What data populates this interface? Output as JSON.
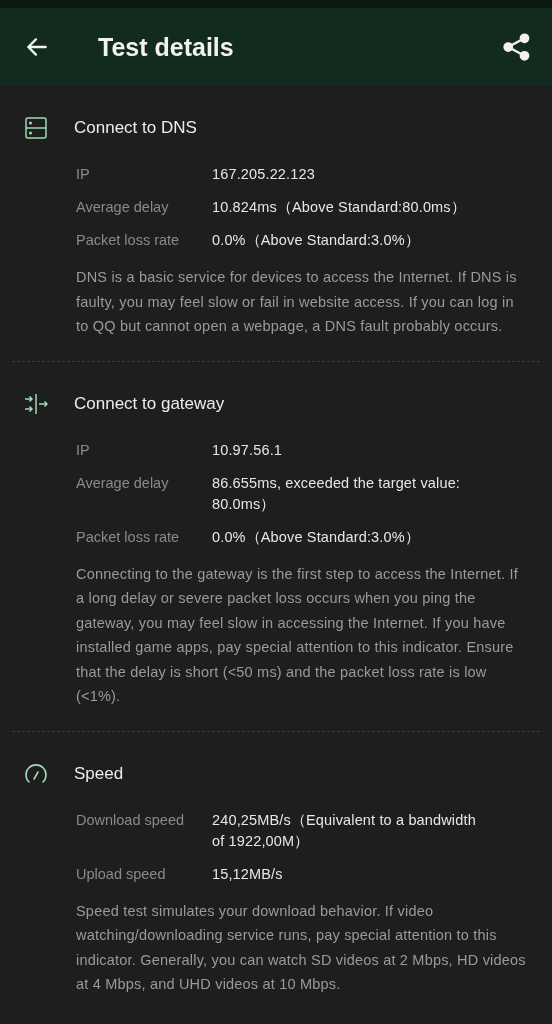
{
  "header": {
    "title": "Test details"
  },
  "sections": [
    {
      "kind": "dns",
      "title": "Connect to DNS",
      "rows": [
        {
          "label": "IP",
          "value": "167.205.22.123"
        },
        {
          "label": "Average delay",
          "value": "10.824ms（Above Standard:80.0ms）"
        },
        {
          "label": "Packet loss rate",
          "value": "0.0%（Above Standard:3.0%）"
        }
      ],
      "description": "DNS is a basic service for devices to access the Internet. If DNS is faulty, you may feel slow or fail in website access. If you can log in to QQ but cannot open a webpage, a DNS fault probably occurs."
    },
    {
      "kind": "gateway",
      "title": "Connect to gateway",
      "rows": [
        {
          "label": "IP",
          "value": "10.97.56.1"
        },
        {
          "label": "Average delay",
          "value": "86.655ms, exceeded the target value: 80.0ms）"
        },
        {
          "label": "Packet loss rate",
          "value": "0.0%（Above Standard:3.0%）"
        }
      ],
      "description": "Connecting to the gateway is the first step to access the Internet. If a long delay or severe packet loss occurs when you ping the gateway, you may feel slow in accessing the Internet. If you have installed game apps, pay special attention to this indicator. Ensure that the delay is short (<50 ms) and the packet loss rate is low (<1%)."
    },
    {
      "kind": "speed",
      "title": "Speed",
      "rows": [
        {
          "label": "Download speed",
          "value": "240,25MB/s（Equivalent to a bandwidth of 1922,00M）"
        },
        {
          "label": "Upload speed",
          "value": "15,12MB/s"
        }
      ],
      "description": "Speed test simulates your download behavior. If video watching/downloading service runs, pay special attention to this indicator. Generally, you can watch SD videos at 2 Mbps, HD videos at 4 Mbps, and UHD videos at 10 Mbps."
    }
  ]
}
